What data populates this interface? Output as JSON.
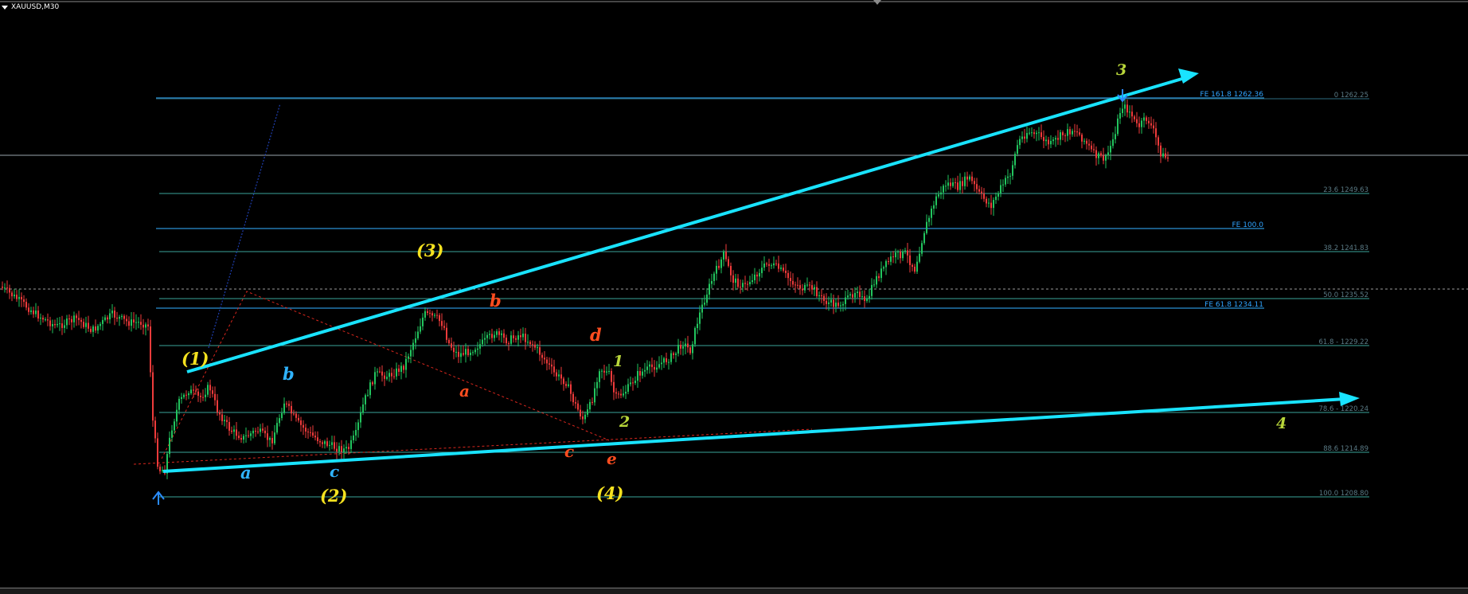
{
  "window": {
    "symbol_label": "XAUUSD,M30"
  },
  "icons": {
    "dropdown": "chevron-down-icon",
    "scroll_marker": "triangle-down-icon"
  },
  "colors": {
    "background": "#000000",
    "bull_candle": "#22c55e",
    "bear_candle": "#ef3b3b",
    "trend_line": "#19e3ff",
    "fib_line": "#2b8fd3",
    "retrace_line": "#3aa39a",
    "wave_yellow": "#f5e21f",
    "wave_red": "#ff4d1f",
    "wave_blue": "#2fb3ff",
    "wave_green": "#b8d63a"
  },
  "fib_expansion": [
    {
      "label": "FE 161.8  1262.36",
      "price": 1262.36
    },
    {
      "label": "FE 100.0",
      "price": 1247.2
    },
    {
      "label": "FE 61.8  1234.11",
      "price": 1234.11
    }
  ],
  "fib_retracement": [
    {
      "label": "0  1262.25",
      "price": 1262.25
    },
    {
      "label": "23.6  1249.63",
      "price": 1249.63
    },
    {
      "label": "38.2  1241.83",
      "price": 1241.83
    },
    {
      "label": "50.0  1235.52",
      "price": 1235.52
    },
    {
      "label": "61.8 - 1229.22",
      "price": 1229.22
    },
    {
      "label": "78.6 - 1220.24",
      "price": 1220.24
    },
    {
      "label": "88.6  1214.89",
      "price": 1214.89
    },
    {
      "label": "100.0  1208.80",
      "price": 1208.8
    }
  ],
  "wave_labels": [
    {
      "text": "(1)",
      "color": "yellow",
      "name": "wave-label-1"
    },
    {
      "text": "(2)",
      "color": "yellow",
      "name": "wave-label-2"
    },
    {
      "text": "(3)",
      "color": "yellow",
      "name": "wave-label-3"
    },
    {
      "text": "(4)",
      "color": "yellow",
      "name": "wave-label-4"
    },
    {
      "text": "a",
      "color": "blue",
      "name": "wave-label-a-blue"
    },
    {
      "text": "b",
      "color": "blue",
      "name": "wave-label-b-blue"
    },
    {
      "text": "c",
      "color": "blue",
      "name": "wave-label-c-blue"
    },
    {
      "text": "a",
      "color": "red",
      "name": "wave-label-a-red"
    },
    {
      "text": "b",
      "color": "red",
      "name": "wave-label-b-red"
    },
    {
      "text": "c",
      "color": "red",
      "name": "wave-label-c-red"
    },
    {
      "text": "d",
      "color": "red",
      "name": "wave-label-d-red"
    },
    {
      "text": "e",
      "color": "red",
      "name": "wave-label-e-red"
    },
    {
      "text": "1",
      "color": "green",
      "name": "wave-label-1-small"
    },
    {
      "text": "2",
      "color": "green",
      "name": "wave-label-2-small"
    },
    {
      "text": "3",
      "color": "green",
      "name": "wave-label-3-small"
    },
    {
      "text": "4",
      "color": "green",
      "name": "wave-label-4-small"
    }
  ],
  "price_axis": {
    "current_price_line": 1254.6,
    "bid_dotted_line": 1236.3
  }
}
